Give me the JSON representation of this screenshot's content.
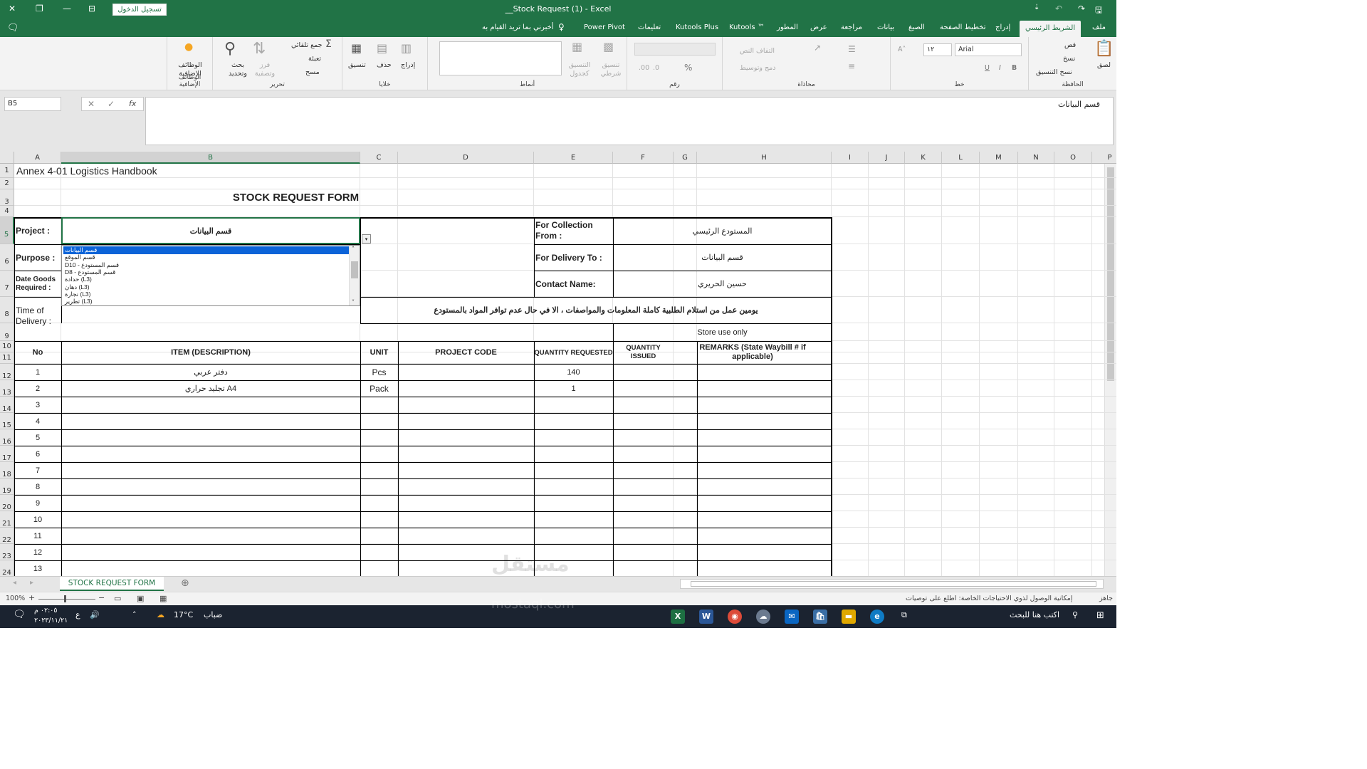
{
  "titlebar": {
    "sign_in": "تسجيل الدخول",
    "title": "__Stock Request (1)  -  Excel",
    "close_icon": "✕",
    "restore_icon": "❐",
    "minimize_icon": "—",
    "ribbon_display_icon": "⊟",
    "save_icon": "🖫",
    "undo_icon": "↶",
    "redo_icon": "↷"
  },
  "tabs": {
    "file": "ملف",
    "home": "الشريط الرئيسي",
    "insert": "إدراج",
    "page_layout": "تخطيط الصفحة",
    "formulas": "الصيغ",
    "data": "بيانات",
    "review": "مراجعة",
    "view": "عرض",
    "developer": "المطور",
    "kutools": "Kutools ™",
    "kutools_plus": "Kutools Plus",
    "help": "تعليمات",
    "power_pivot": "Power Pivot",
    "tell_me": "أخبرني بما تريد القيام به"
  },
  "ribbon": {
    "clipboard": {
      "label": "الحافظة",
      "paste": "لصق",
      "cut": "قص",
      "copy": "نسخ",
      "format_painter": "نسخ التنسيق"
    },
    "font": {
      "label": "خط",
      "font_name": "Arial",
      "font_size": "١٢",
      "bold": "B",
      "italic": "I",
      "underline": "U"
    },
    "alignment": {
      "label": "محاذاة",
      "wrap": "التفاف النص",
      "merge": "دمج وتوسيط"
    },
    "number": {
      "label": "رقم",
      "percent": "%"
    },
    "styles": {
      "label": "أنماط",
      "conditional": "تنسيق شرطي",
      "as_table": "التنسيق كجدول"
    },
    "cells": {
      "label": "خلايا",
      "insert": "إدراج",
      "delete": "حذف",
      "format": "تنسيق"
    },
    "editing": {
      "label": "تحرير",
      "autosum": "جمع تلقائي",
      "fill": "تعبئة",
      "clear": "مسح",
      "sort": "فرز وتصفية",
      "find": "بحث وتحديد"
    },
    "addins": {
      "label": "الوظائف الإضافية",
      "addins": "الوظائف الإضافية"
    }
  },
  "formula_bar": {
    "name_box": "B5",
    "cancel": "✕",
    "enter": "✓",
    "fx": "fx",
    "content": "قسم البيانات"
  },
  "columns": [
    "A",
    "B",
    "C",
    "D",
    "E",
    "F",
    "G",
    "H",
    "I",
    "J",
    "K",
    "L",
    "M",
    "N",
    "O",
    "P"
  ],
  "rows": [
    "1",
    "2",
    "3",
    "4",
    "5",
    "6",
    "7",
    "8",
    "9",
    "10",
    "11",
    "12",
    "13",
    "14",
    "15",
    "16",
    "17",
    "18",
    "19",
    "20",
    "21",
    "22",
    "23",
    "24"
  ],
  "sheet": {
    "a1": "Annex 4-01 Logistics Handbook",
    "title": "STOCK REQUEST FORM",
    "project_label": "Project :",
    "project_value": "قسم البيانات",
    "purpose_label": "Purpose :",
    "date_label": "Date Goods Required :",
    "time_label": "Time of Delivery :",
    "collection_label": "For Collection From :",
    "collection_value": "المستودع الرئيسي",
    "delivery_label": "For Delivery To :",
    "delivery_value": "قسم البيانات",
    "contact_label": "Contact Name:",
    "contact_value": "حسين الحريري",
    "notice": "يومين عمل من استلام الطلبية كاملة المعلومات والمواصفات ، الا في حال عدم توافر المواد بالمستودع",
    "store_use": "Store use only",
    "headers": {
      "no": "No",
      "item": "ITEM (DESCRIPTION)",
      "unit": "UNIT",
      "project_code": "PROJECT CODE",
      "qty_requested": "QUANTITY REQUESTED",
      "qty_issued": "QUANTITY ISSUED",
      "remarks": "REMARKS (State Waybill # if applicable)"
    },
    "items": [
      {
        "no": "1",
        "item": "دفتر عربي",
        "unit": "Pcs",
        "qty": "140"
      },
      {
        "no": "2",
        "item": "تجليد حراري A4",
        "unit": "Pack",
        "qty": "1"
      },
      {
        "no": "3",
        "item": "",
        "unit": "",
        "qty": ""
      },
      {
        "no": "4",
        "item": "",
        "unit": "",
        "qty": ""
      },
      {
        "no": "5",
        "item": "",
        "unit": "",
        "qty": ""
      },
      {
        "no": "6",
        "item": "",
        "unit": "",
        "qty": ""
      },
      {
        "no": "7",
        "item": "",
        "unit": "",
        "qty": ""
      },
      {
        "no": "8",
        "item": "",
        "unit": "",
        "qty": ""
      },
      {
        "no": "9",
        "item": "",
        "unit": "",
        "qty": ""
      },
      {
        "no": "10",
        "item": "",
        "unit": "",
        "qty": ""
      },
      {
        "no": "11",
        "item": "",
        "unit": "",
        "qty": ""
      },
      {
        "no": "12",
        "item": "",
        "unit": "",
        "qty": ""
      },
      {
        "no": "13",
        "item": "",
        "unit": "",
        "qty": ""
      }
    ]
  },
  "dropdown": {
    "options": [
      "قسم البيانات",
      "قسم الموقع",
      "D10 - قسم المستودع",
      "D8 - قسم المستودع",
      "حدادة (L3)",
      "دهان (L3)",
      "نجارة (L3)",
      "تطرير (L3)"
    ],
    "selected_index": 0
  },
  "sheet_tabs": {
    "active": "STOCK REQUEST FORM",
    "add": "⊕"
  },
  "status": {
    "ready": "جاهز",
    "accessibility": "إمكانية الوصول لذوي الاحتياجات الخاصة: اطلع على توصيات",
    "zoom": "100%"
  },
  "taskbar": {
    "search": "اكتب هنا للبحث",
    "weather_temp": "17°C",
    "weather_desc": "ضباب",
    "time": "٠٢:٠٥ م",
    "date": "٢٠٢٣/١١/٢١",
    "lang": "ع"
  },
  "watermark": {
    "arabic": "مستقل",
    "latin": "mostaql.com"
  },
  "colors": {
    "excel_green": "#217346",
    "selection_blue": "#0b63d8",
    "taskbar": "#1b2330"
  }
}
